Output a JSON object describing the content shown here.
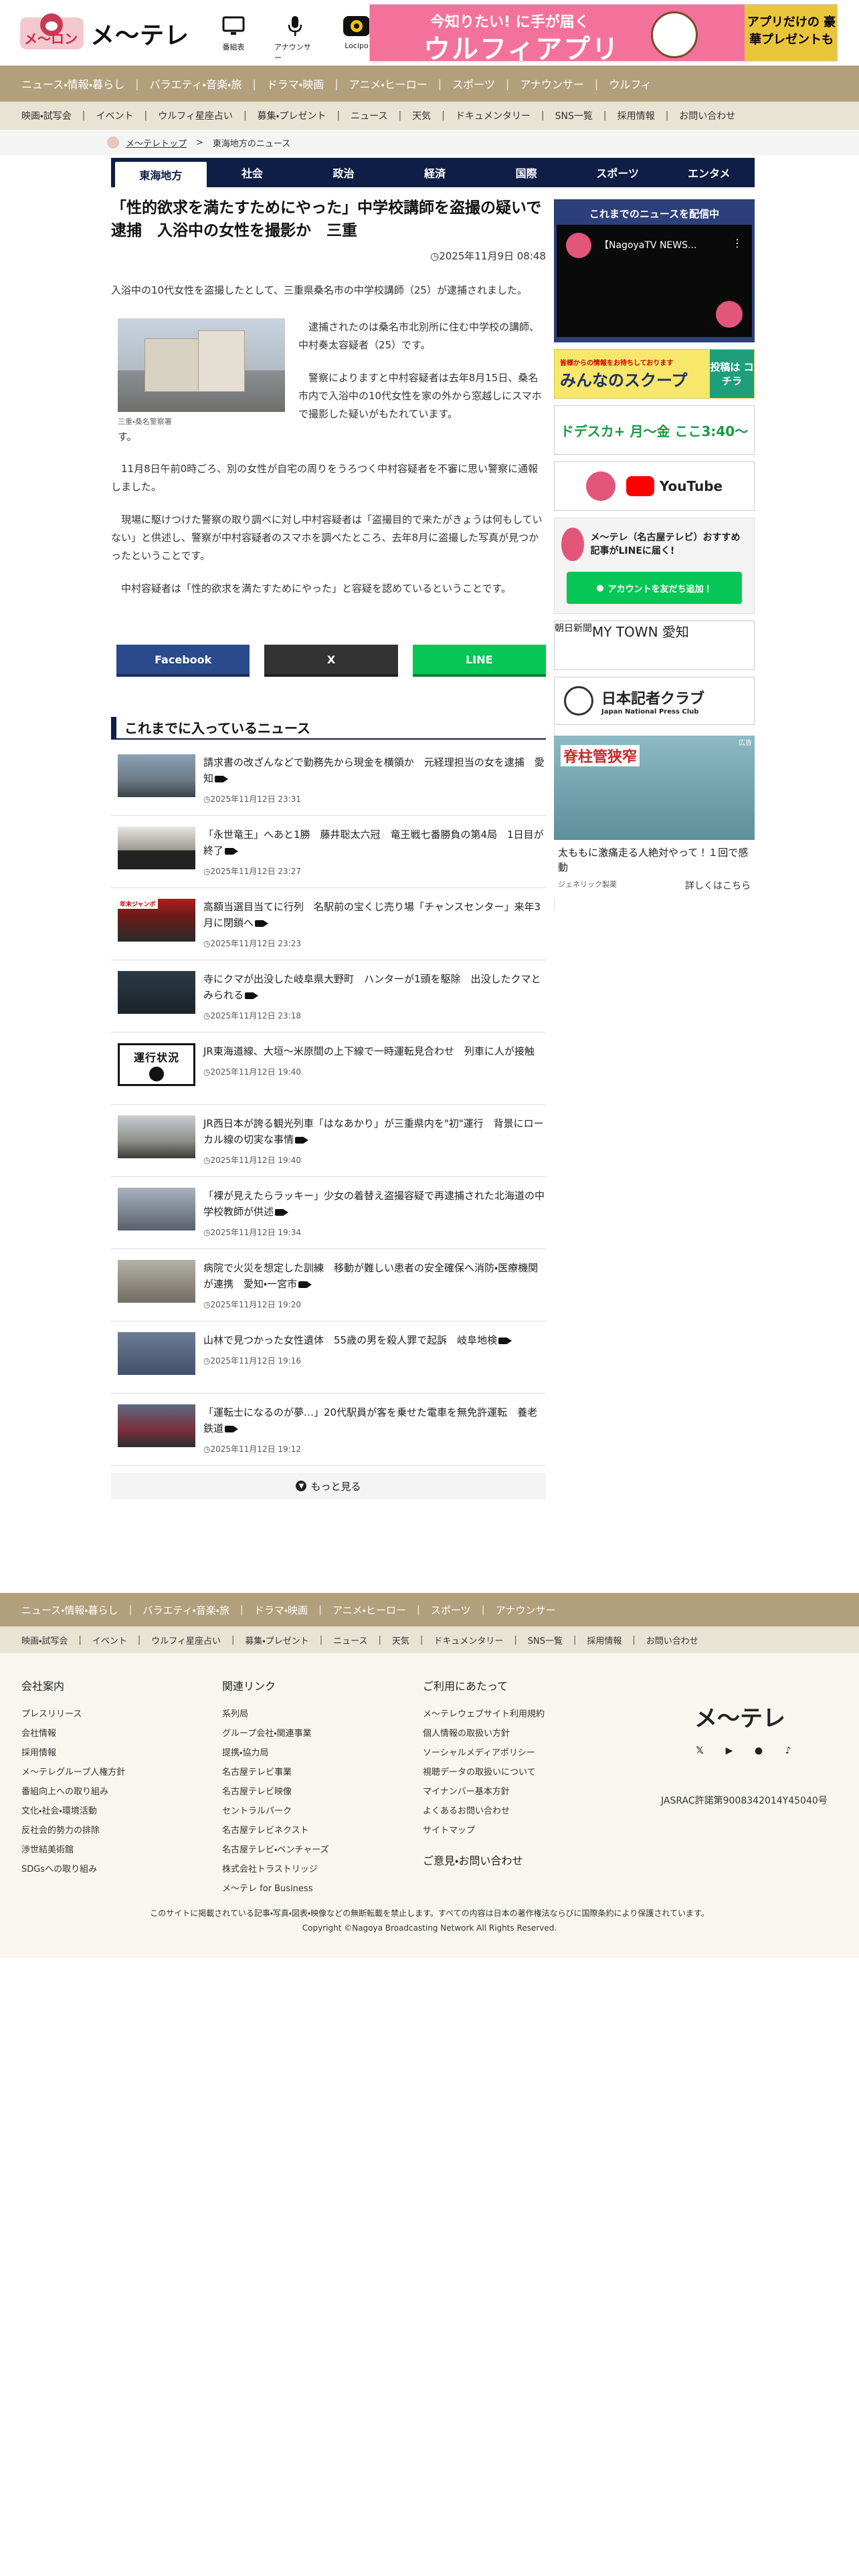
{
  "header": {
    "logo_badge": "メ〜ロン",
    "logo_name": "メ〜テレ",
    "icons": [
      {
        "icon": "tv-icon",
        "label": "番組表"
      },
      {
        "icon": "microphone-icon",
        "label": "アナウンサー"
      },
      {
        "icon": "locipo-icon",
        "label": "Locipo"
      }
    ],
    "ad": {
      "line1": "今知りたい! に手が届く",
      "line2": "ウルフィアプリ",
      "right": "アプリだけの 豪華プレゼントも"
    }
  },
  "nav_primary": [
    "ニュース・情報・暮らし",
    "バラエティ・音楽・旅",
    "ドラマ・映画",
    "アニメ・ヒーロー",
    "スポーツ",
    "アナウンサー",
    "ウルフィ"
  ],
  "nav_secondary": [
    "映画・試写会",
    "イベント",
    "ウルフィ星座占い",
    "募集・プレゼント",
    "ニュース",
    "天気",
    "ドキュメンタリー",
    "SNS一覧",
    "採用情報",
    "お問い合わせ"
  ],
  "breadcrumb": {
    "top": "メ〜テレトップ",
    "arrow": ">",
    "current": "東海地方のニュース"
  },
  "categories": [
    "東海地方",
    "社会",
    "政治",
    "経済",
    "国際",
    "スポーツ",
    "エンタメ"
  ],
  "article": {
    "title": "「性的欲求を満たすためにやった」中学校講師を盗撮の疑いで逮捕　入浴中の女性を撮影か　三重",
    "date": "2025年11月9日 08:48",
    "lead": "入浴中の10代女性を盗撮したとして、三重県桑名市の中学校講師（25）が逮捕されました。",
    "fig_caption": "三重・桑名警察署",
    "fig_text_1": "逮捕されたのは桑名市北別所に住む中学校の講師、中村奏太容疑者（25）です。",
    "fig_text_2": "警察によりますと中村容疑者は去年8月15日、桑名市内で入浴中の10代女性を家の外から窓越しにスマホで撮影した疑いがもたれています。",
    "fig_text_end": "す。",
    "para1": "11月8日午前0時ごろ、別の女性が自宅の周りをうろつく中村容疑者を不審に思い警察に通報しました。",
    "para2": "現場に駆けつけた警察の取り調べに対し中村容疑者は「盗撮目的で来たがきょうは何もしていない」と供述し、警察が中村容疑者のスマホを調べたところ、去年8月に盗撮した写真が見つかったということです。",
    "para3": "中村容疑者は「性的欲求を満たすためにやった」と容疑を認めているということです。"
  },
  "share": {
    "facebook": {
      "label": "Facebook",
      "color": "#2b4a8b"
    },
    "x": {
      "label": "X",
      "color": "#333333"
    },
    "line": {
      "label": "LINE",
      "color": "#06c755"
    }
  },
  "latest": {
    "heading": "これまでに入っているニュース",
    "items": [
      {
        "title": "請求書の改ざんなどで勤務先から現金を横領か　元経理担当の女を逮捕　愛知",
        "video": true,
        "time": "2025年11月12日 23:31"
      },
      {
        "title": "「永世竜王」へあと1勝　藤井聡太六冠　竜王戦七番勝負の第4局　1日目が終了",
        "video": true,
        "time": "2025年11月12日 23:27"
      },
      {
        "title": "高額当選目当てに行列　名駅前の宝くじ売り場「チャンスセンター」来年3月に閉鎖へ",
        "video": true,
        "time": "2025年11月12日 23:23",
        "thumb_label": "年末ジャンボ"
      },
      {
        "title": "寺にクマが出没した岐阜県大野町　ハンターが1頭を駆除　出没したクマとみられる",
        "video": true,
        "time": "2025年11月12日 23:18"
      },
      {
        "title": "JR東海道線、大垣〜米原間の上下線で一時運転見合わせ　列車に人が接触",
        "video": false,
        "time": "2025年11月12日 19:40",
        "thumb_text": "運行状況"
      },
      {
        "title": "JR西日本が誇る観光列車「はなあかり」が三重県内を\"初\"運行　背景にローカル線の切実な事情",
        "video": true,
        "time": "2025年11月12日 19:40"
      },
      {
        "title": "「裸が見えたらラッキー」少女の着替え盗撮容疑で再逮捕された北海道の中学校教師が供述",
        "video": true,
        "time": "2025年11月12日 19:34"
      },
      {
        "title": "病院で火災を想定した訓練　移動が難しい患者の安全確保へ消防・医療機関が連携　愛知・一宮市",
        "video": true,
        "time": "2025年11月12日 19:20"
      },
      {
        "title": "山林で見つかった女性遺体　55歳の男を殺人罪で起訴　岐阜地検",
        "video": true,
        "time": "2025年11月12日 19:16"
      },
      {
        "title": "「運転士になるのが夢…」20代駅員が客を乗せた電車を無免許運転　養老鉄道",
        "video": true,
        "time": "2025年11月12日 19:12"
      }
    ],
    "more": "もっと見る"
  },
  "sidebar": {
    "video_head": "これまでのニュースを配信中",
    "video_title": "【NagoyaTV NEWS...",
    "scoop_left": "みんなのスクープ",
    "scoop_top": "皆様からの情報をお待ちしております",
    "scoop_right": "投稿は コチラ",
    "dora": "ドデスカ+ 月〜金 ここ3:40〜",
    "yt": "YouTube",
    "line_title": "メ〜テレ（名古屋テレビ）おすすめ記事がLINEに届く!",
    "line_btn": "アカウントを友だち追加！",
    "asahi": "朝日新聞",
    "mytown": "MY TOWN 愛知",
    "press_name": "日本記者クラブ",
    "press_en": "Japan National Press Club",
    "ad_img_text": "脊柱管狭窄",
    "ad_tag": "広告",
    "ad_caption": "太ももに激痛走る人絶対やって！１回で感動",
    "ad_sponsor": "ジェネリック製薬",
    "ad_detail": "詳しくはこちら"
  },
  "footer": {
    "nav_primary": [
      "ニュース・情報・暮らし",
      "バラエティ・音楽・旅",
      "ドラマ・映画",
      "アニメ・ヒーロー",
      "スポーツ",
      "アナウンサー"
    ],
    "nav_secondary": [
      "映画・試写会",
      "イベント",
      "ウルフィ星座占い",
      "募集・プレゼント",
      "ニュース",
      "天気",
      "ドキュメンタリー",
      "SNS一覧",
      "採用情報",
      "お問い合わせ"
    ],
    "col1": {
      "title": "会社案内",
      "items": [
        "プレスリリース",
        "会社情報",
        "採用情報",
        "メ〜テレグループ人権方針",
        "番組向上への取り組み",
        "文化・社会・環境活動",
        "反社会的勢力の排除",
        "渉世結美術館",
        "SDGsへの取り組み"
      ]
    },
    "col2": {
      "title": "関連リンク",
      "items": [
        "系列局",
        "グループ会社・関連事業",
        "提携・協力局",
        "名古屋テレビ事業",
        "名古屋テレビ映像",
        "セントラルパーク",
        "名古屋テレビネクスト",
        "名古屋テレビ・ベンチャーズ",
        "株式会社トラストリッジ",
        "メ〜テレ for Business"
      ]
    },
    "col3": {
      "title": "ご利用にあたって",
      "items": [
        "メ〜テレウェブサイト利用規約",
        "個人情報の取扱い方針",
        "ソーシャルメディアポリシー",
        "視聴データの取扱いについて",
        "マイナンバー基本方針",
        "よくあるお問い合わせ",
        "サイトマップ"
      ],
      "extra": "ご意見・お問い合わせ"
    },
    "logo": "メ〜テレ",
    "jasrac": "JASRAC許諾第9008342014Y45040号",
    "copy1": "このサイトに掲載されている記事・写真・図表・映像などの無断転載を禁止します。すべての内容は日本の著作権法ならびに国際条約により保護されています。",
    "copy2": "Copyright ©Nagoya Broadcasting Network All Rights Reserved."
  }
}
